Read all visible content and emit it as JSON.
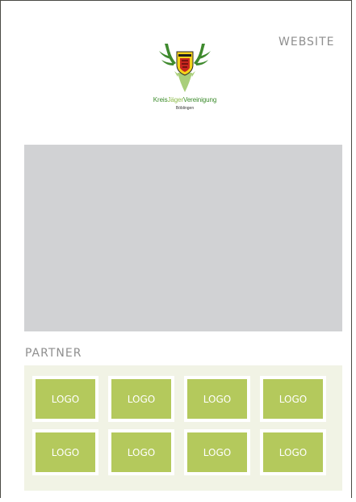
{
  "header": {
    "website_label": "WEBSITE"
  },
  "brand": {
    "name_part1": "Kreis",
    "name_part2": "Jäger",
    "name_part3": "Vereinigung",
    "subtitle": "Böblingen",
    "icon": "antler-crest-icon"
  },
  "hero": {
    "placeholder": "image-placeholder"
  },
  "partners": {
    "heading": "PARTNER",
    "logos": [
      "LOGO",
      "LOGO",
      "LOGO",
      "LOGO",
      "LOGO",
      "LOGO",
      "LOGO",
      "LOGO"
    ]
  },
  "colors": {
    "accent": "#b4c95c",
    "panel": "#f1f3e5",
    "placeholder": "#d1d2d4",
    "brand_green": "#3a8a2a"
  }
}
